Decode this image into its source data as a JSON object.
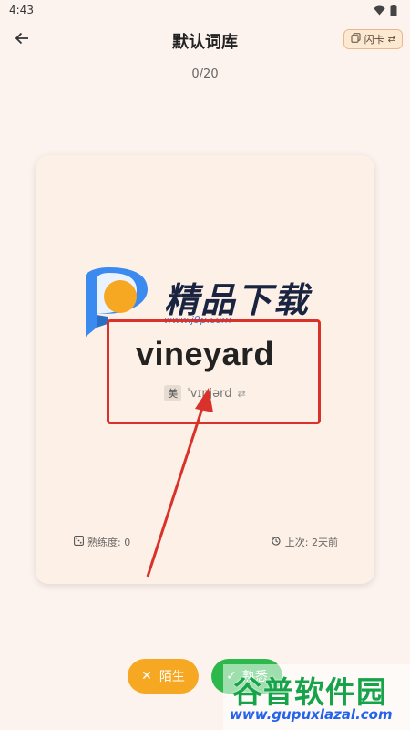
{
  "status_bar": {
    "time": "4:43"
  },
  "header": {
    "title": "默认词库",
    "mode_label": "闪卡",
    "progress": "0/20"
  },
  "card": {
    "word": "vineyard",
    "accent": "美",
    "phonetic": "ˈvɪnjərd",
    "proficiency": "熟练度: 0",
    "last_review": "上次: 2天前"
  },
  "actions": {
    "unfamiliar_label": "陌生",
    "familiar_label": "熟悉"
  },
  "watermark": {
    "title": "精品下载",
    "url": "www.j9p.com"
  },
  "corner_watermark": {
    "title": "谷普软件园",
    "url": "www.gupuxlazal.com"
  },
  "colors": {
    "background": "#fdf3ee",
    "card": "#fdf0e6",
    "accent_orange": "#f7a823",
    "accent_green": "#2cb84b",
    "highlight_red": "#d9322b"
  }
}
